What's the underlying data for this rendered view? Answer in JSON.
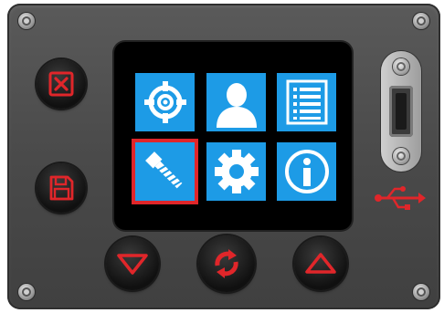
{
  "device": {
    "icons": {
      "screws": "screw-icon",
      "usb": "usb-icon",
      "cancel": "close-box-icon",
      "save": "floppy-disk-icon",
      "down": "triangle-down-icon",
      "refresh": "refresh-icon",
      "up": "triangle-up-icon"
    },
    "menu": [
      {
        "name": "target",
        "icon": "crosshair-icon",
        "selected": false
      },
      {
        "name": "user",
        "icon": "user-icon",
        "selected": false
      },
      {
        "name": "list",
        "icon": "list-icon",
        "selected": false
      },
      {
        "name": "tool",
        "icon": "bolt-icon",
        "selected": true
      },
      {
        "name": "settings",
        "icon": "gear-icon",
        "selected": false
      },
      {
        "name": "info",
        "icon": "info-icon",
        "selected": false
      }
    ],
    "colors": {
      "panel": "#4d4d4d",
      "screen": "#000000",
      "tile": "#1d9be6",
      "accent_red": "#e0262a",
      "white": "#ffffff"
    }
  }
}
